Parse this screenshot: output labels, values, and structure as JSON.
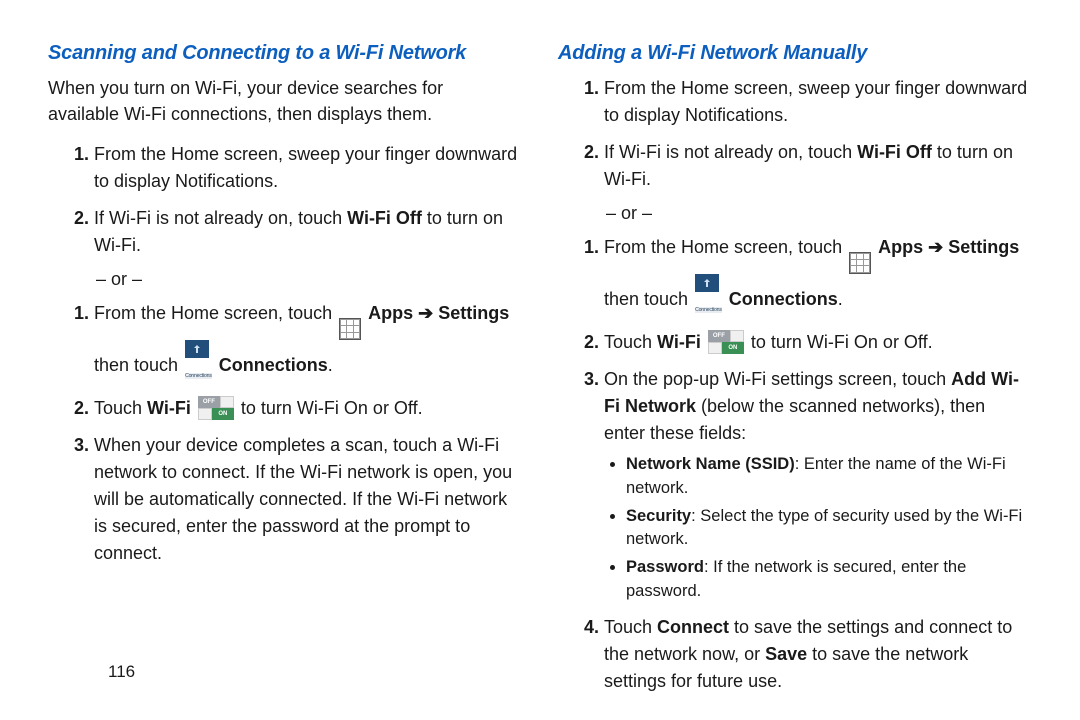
{
  "left": {
    "heading": "Scanning and Connecting to a Wi-Fi Network",
    "intro": "When you turn on Wi-Fi, your device searches for available Wi-Fi connections, then displays them.",
    "listA": {
      "s1": "From the Home screen, sweep your finger downward to display Notifications.",
      "s2_pre": "If Wi-Fi is not already on, touch ",
      "s2_b": "Wi-Fi Off",
      "s2_post": " to turn on Wi-Fi."
    },
    "or": "– or –",
    "listB": {
      "s1_pre": "From the Home screen, touch ",
      "s1_apps": "Apps",
      "s1_arrow": "➔",
      "s1_settings": "Settings",
      "s1_then": " then touch ",
      "s1_conn": "Connections",
      "s1_dot": ".",
      "s2_pre": "Touch ",
      "s2_wifi": "Wi-Fi",
      "s2_post": " to turn Wi-Fi On or Off.",
      "s3": "When your device completes a scan, touch a Wi-Fi network to connect. If the Wi-Fi network is open, you will be automatically connected. If the Wi-Fi network is secured, enter the password at the prompt to connect."
    }
  },
  "right": {
    "heading": "Adding a Wi-Fi Network Manually",
    "listA": {
      "s1": "From the Home screen, sweep your finger downward to display Notifications.",
      "s2_pre": "If Wi-Fi is not already on, touch ",
      "s2_b": "Wi-Fi Off",
      "s2_post": " to turn on Wi-Fi."
    },
    "or": "– or –",
    "listB": {
      "s1_pre": "From the Home screen, touch ",
      "s1_apps": "Apps",
      "s1_arrow": "➔",
      "s1_settings": "Settings",
      "s1_then": " then touch ",
      "s1_conn": "Connections",
      "s1_dot": ".",
      "s2_pre": "Touch ",
      "s2_wifi": "Wi-Fi",
      "s2_post": " to turn Wi-Fi On or Off.",
      "s3_pre": "On the pop-up Wi-Fi settings screen, touch ",
      "s3_b": "Add Wi-Fi Network",
      "s3_post": " (below the scanned networks), then enter these fields:",
      "bullets": {
        "b1_b": "Network Name (SSID)",
        "b1_t": ": Enter the name of the Wi-Fi network.",
        "b2_b": "Security",
        "b2_t": ": Select the type of security used by the Wi-Fi network.",
        "b3_b": "Password",
        "b3_t": ": If the network is secured, enter the password."
      },
      "s4_pre": "Touch ",
      "s4_b1": "Connect",
      "s4_mid": " to save the settings and connect to the network now, or ",
      "s4_b2": "Save",
      "s4_post": " to save the network settings for future use."
    }
  },
  "icons": {
    "conn_label": "Connections",
    "off": "OFF",
    "on": "ON"
  },
  "page_number": "116"
}
